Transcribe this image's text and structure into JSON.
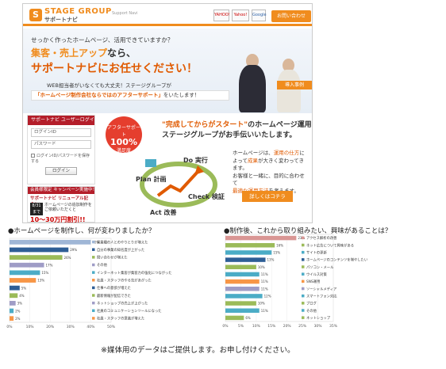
{
  "site": {
    "logo_mark": "S",
    "logo_text": "STAGE GROUP",
    "logo_sub": "サポートナビ",
    "support_label": "Support Navi",
    "badges": [
      "YAHOO!",
      "Yahoo!",
      "Google"
    ],
    "contact_label": "お問い合わせ",
    "hero": {
      "lead": "せっかく作ったホームページ、活用できていますか？",
      "h1_accent": "集客・売上アップ",
      "h1_rest": "なら、",
      "h2": "サポートナビにお任せください！",
      "note": "WEB担当者がいなくても大丈夫！ステージグループが",
      "band_accent": "「ホームページ制作会社ならではのアフターサポート」",
      "band_rest": "をいたします！",
      "case_label": "導入事例"
    },
    "login": {
      "header": "サポートナビ ユーザーログイン",
      "id_label": "ログインID",
      "pw_label": "パスワード",
      "remember_label": "ログインID/パスワードを保存する",
      "button_label": "ログイン"
    },
    "promo": {
      "header": "会員様限定 キャンペーン実施中！",
      "sub": "サポートナビ リニューアル記念！",
      "date": "8/31まで",
      "text": "ホームページの追加制作を ご依頼いただくと",
      "price": "10～30万円割引!!"
    },
    "seal": {
      "line1": "アフターサポート",
      "big": "100%",
      "line2": "満足度"
    },
    "mid": {
      "accent": "\"完成してからがスタート\"",
      "rest": "のホームページ運用",
      "line2": "ステージグループがお手伝いいたします。"
    },
    "cycle_labels": [
      "Plan 計画",
      "Do 実行",
      "Check 検証",
      "Act 改善"
    ],
    "right_text": {
      "l1": "ホームページは、",
      "l1_hl": "運用の仕方",
      "l1_end": "に",
      "l2_hl": "成果",
      "l2_rest": "が大きく変わってきます。",
      "l3": "お客様と一緒に、目的に合わせて",
      "l4_hl": "最適な運用方法",
      "l4_rest": "を考えます。"
    },
    "detail_label": "詳しくはコチラ"
  },
  "chart_titles": {
    "left": "●ホームページを制作し、何が変わりましたか？",
    "right": "●制作後、これから取り組みたい、興味があることは？"
  },
  "chart_data": [
    {
      "type": "bar",
      "orientation": "horizontal",
      "categories": [
        "異業種の人とのやりとりが増えた",
        "自分の事業の知名度が上がった",
        "問い合わせが増えた",
        "その他",
        "インターネット集客が集客力の強化につながった",
        "社員・スタッフのやる気があがった",
        "仕事への意欲が増えた",
        "最新情報が配信できた",
        "ネットショップの売上が上がった",
        "社員のコミュニケーションツールになった",
        "社員・スタッフの意識が増えた"
      ],
      "values": [
        40,
        29,
        26,
        17,
        15,
        13,
        5,
        4,
        3,
        2,
        2
      ],
      "xticks": [
        "0%",
        "10%",
        "20%",
        "30%",
        "40%",
        "50%"
      ],
      "xlim": [
        0,
        50
      ],
      "colors": [
        "#9fb6d6",
        "#2e5e96",
        "#9bbb59",
        "#9f9cc6",
        "#4bacc6",
        "#f79646",
        "#2e5e96",
        "#9bbb59",
        "#9f9cc6",
        "#4bacc6",
        "#f79646"
      ]
    },
    {
      "type": "bar",
      "orientation": "horizontal",
      "categories": [
        "アクセス解析の改善",
        "ネット広告について興味がある",
        "サイトの更新",
        "ホームページのコンテンツを増やしたい",
        "パソコン・メール",
        "ウイルス対策",
        "SNS運用",
        "ソーシャルメディア",
        "スマートフォン対応",
        "ブログ",
        "その他",
        "ネットショップ"
      ],
      "values": [
        23,
        16,
        15,
        13,
        10,
        11,
        11,
        11,
        12,
        10,
        11,
        6
      ],
      "xticks": [
        "0%",
        "5%",
        "10%",
        "15%",
        "20%",
        "25%",
        "30%",
        "35%"
      ],
      "xlim": [
        0,
        35
      ],
      "colors": [
        "#d99694",
        "#9bbb59",
        "#4bacc6",
        "#2e5e96",
        "#9bbb59",
        "#4bacc6",
        "#f79646",
        "#9f9cc6",
        "#4bacc6",
        "#9bbb59",
        "#4bacc6",
        "#9bbb59"
      ]
    }
  ],
  "footnote": "※媒体用のデータはご提供します。お申し付けください。"
}
